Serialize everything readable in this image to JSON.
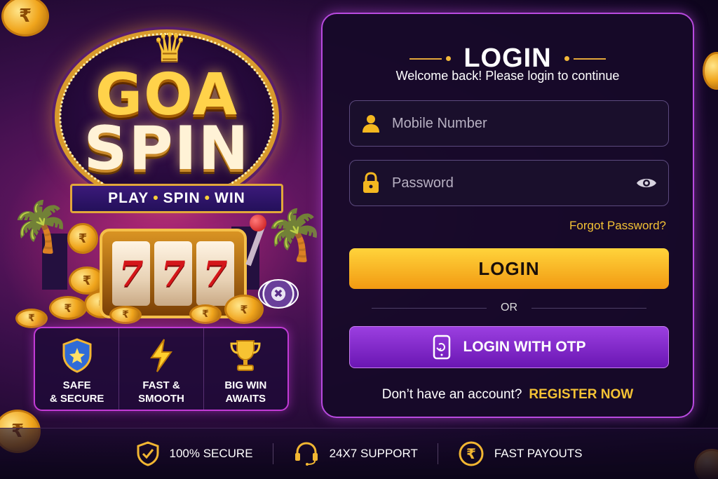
{
  "brand": {
    "logo_line1": "GOA",
    "logo_line2": "SPIN",
    "tagline_parts": [
      "PLAY",
      "SPIN",
      "WIN"
    ],
    "reels": [
      "7",
      "7",
      "7"
    ]
  },
  "features": [
    {
      "icon": "shield-icon",
      "line1": "SAFE",
      "line2": "& SECURE"
    },
    {
      "icon": "lightning-icon",
      "line1": "FAST &",
      "line2": "SMOOTH"
    },
    {
      "icon": "trophy-icon",
      "line1": "BIG WIN",
      "line2": "AWAITS"
    }
  ],
  "login": {
    "title": "LOGIN",
    "subtitle": "Welcome back! Please login to continue",
    "mobile_placeholder": "Mobile Number",
    "password_placeholder": "Password",
    "forgot_label": "Forgot Password?",
    "login_button": "LOGIN",
    "or_label": "OR",
    "otp_button": "LOGIN WITH OTP",
    "no_account_text": "Don’t have an account?",
    "register_label": "REGISTER NOW"
  },
  "bottom_bar": [
    {
      "icon": "shield-check-icon",
      "label": "100% SECURE"
    },
    {
      "icon": "headset-icon",
      "label": "24X7 SUPPORT"
    },
    {
      "icon": "rupee-coin-icon",
      "label": "FAST PAYOUTS"
    }
  ],
  "colors": {
    "accent_gold": "#f4c235",
    "accent_purple": "#b94ae0",
    "login_button": "#f5b020",
    "otp_button": "#8a2be2"
  }
}
